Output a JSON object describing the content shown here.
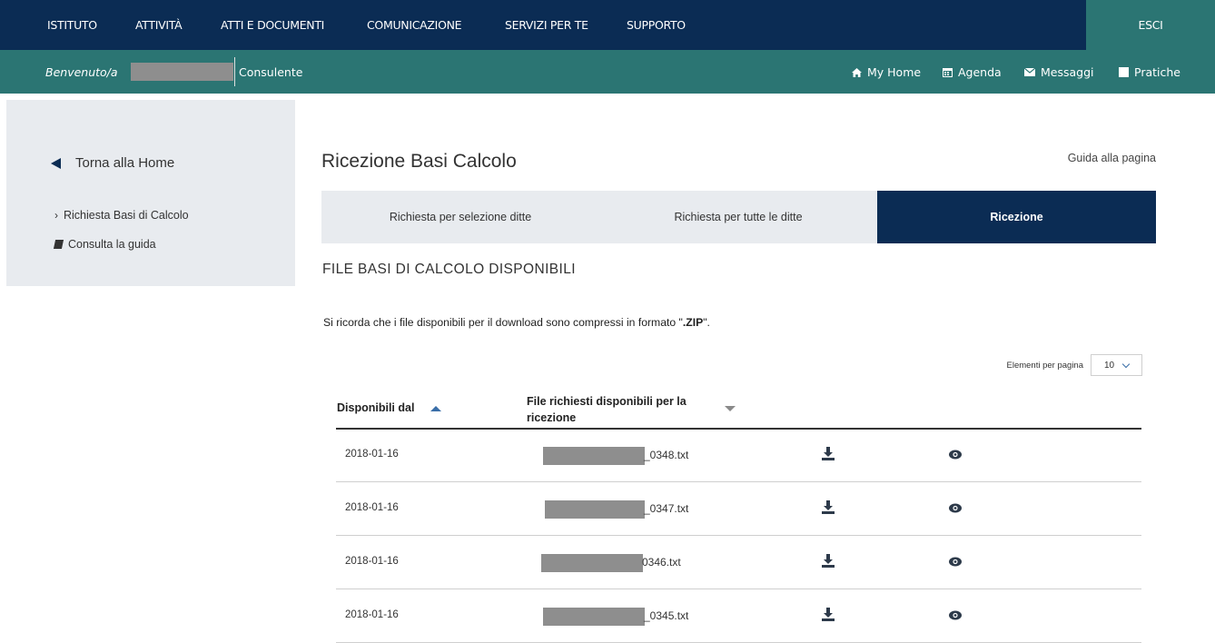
{
  "topnav": {
    "items": [
      "ISTITUTO",
      "ATTIVITÀ",
      "ATTI E DOCUMENTI",
      "COMUNICAZIONE",
      "SERVIZI PER TE",
      "SUPPORTO"
    ],
    "logout": "ESCI"
  },
  "subbar": {
    "welcome": "Benvenuto/a",
    "role": "Consulente",
    "links": [
      {
        "label": "My Home",
        "icon": "home-icon"
      },
      {
        "label": "Agenda",
        "icon": "calendar-icon"
      },
      {
        "label": "Messaggi",
        "icon": "envelope-icon"
      },
      {
        "label": "Pratiche",
        "icon": "folder-icon"
      }
    ]
  },
  "sidebar": {
    "back": "Torna alla Home",
    "links": [
      "Richiesta Basi di Calcolo",
      "Consulta la guida"
    ]
  },
  "main": {
    "title": "Ricezione Basi Calcolo",
    "guide_link": "Guida alla pagina",
    "tabs": [
      "Richiesta per selezione ditte",
      "Richiesta per tutte le ditte",
      "Ricezione"
    ],
    "active_tab": "Ricezione",
    "section_title": "FILE BASI DI CALCOLO DISPONIBILI",
    "note_prefix": "Si ricorda che i file disponibili per il download sono compressi in formato \"",
    "note_bold": ".ZIP",
    "note_suffix": "\".",
    "per_page_label": "Elementi per pagina",
    "per_page_value": "10",
    "table": {
      "headers": [
        "Disponibili dal",
        "File richiesti disponibili per la ricezione"
      ],
      "rows": [
        {
          "date": "2018-01-16",
          "file": "_0348.txt"
        },
        {
          "date": "2018-01-16",
          "file": "_0347.txt"
        },
        {
          "date": "2018-01-16",
          "file": "0346.txt"
        },
        {
          "date": "2018-01-16",
          "file": "_0345.txt"
        }
      ]
    }
  },
  "colors": {
    "navy": "#0b2c54",
    "teal": "#2b7573",
    "panel": "#e8ebef",
    "redaction": "#8e8e8e"
  }
}
